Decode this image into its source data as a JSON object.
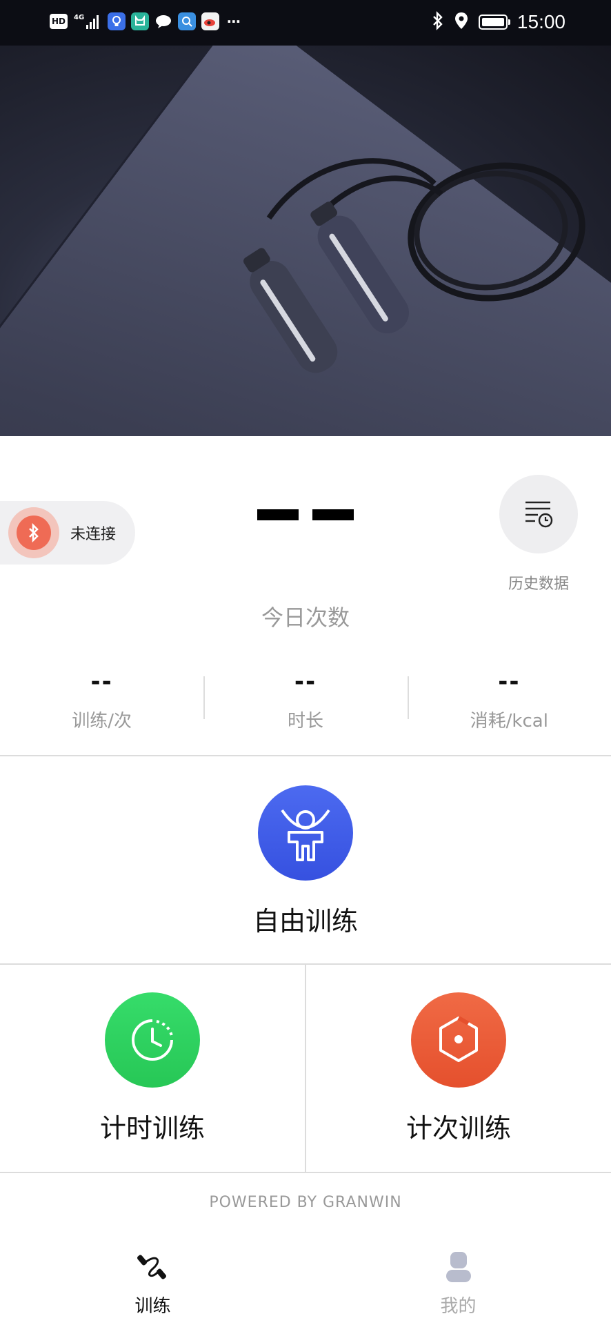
{
  "status_bar": {
    "hd_label": "HD",
    "network_label": "4G",
    "time": "15:00",
    "icons": [
      "hd-icon",
      "signal-icon",
      "app-bulb-icon",
      "app-cat-icon",
      "message-icon",
      "search-app-icon",
      "weibo-icon",
      "more-dots-icon",
      "bluetooth-icon",
      "location-icon",
      "battery-icon"
    ]
  },
  "device": {
    "status": "未连接",
    "bluetooth_color": "#ef6b55"
  },
  "today": {
    "count_display": "— —",
    "label": "今日次数"
  },
  "history": {
    "label": "历史数据"
  },
  "stats": [
    {
      "value": "--",
      "label": "训练/次"
    },
    {
      "value": "--",
      "label": "时长"
    },
    {
      "value": "--",
      "label": "消耗/kcal"
    }
  ],
  "modes": {
    "free": {
      "label": "自由训练",
      "color": "#3f5ae6"
    },
    "timed": {
      "label": "计时训练",
      "color": "#2fd460"
    },
    "counted": {
      "label": "计次训练",
      "color": "#ec5a36"
    }
  },
  "footer": {
    "powered_by": "POWERED BY GRANWIN"
  },
  "tabbar": {
    "tabs": [
      {
        "label": "训练",
        "active": true
      },
      {
        "label": "我的",
        "active": false
      }
    ],
    "active_color": "#111111",
    "inactive_color": "#aaaaaa"
  }
}
